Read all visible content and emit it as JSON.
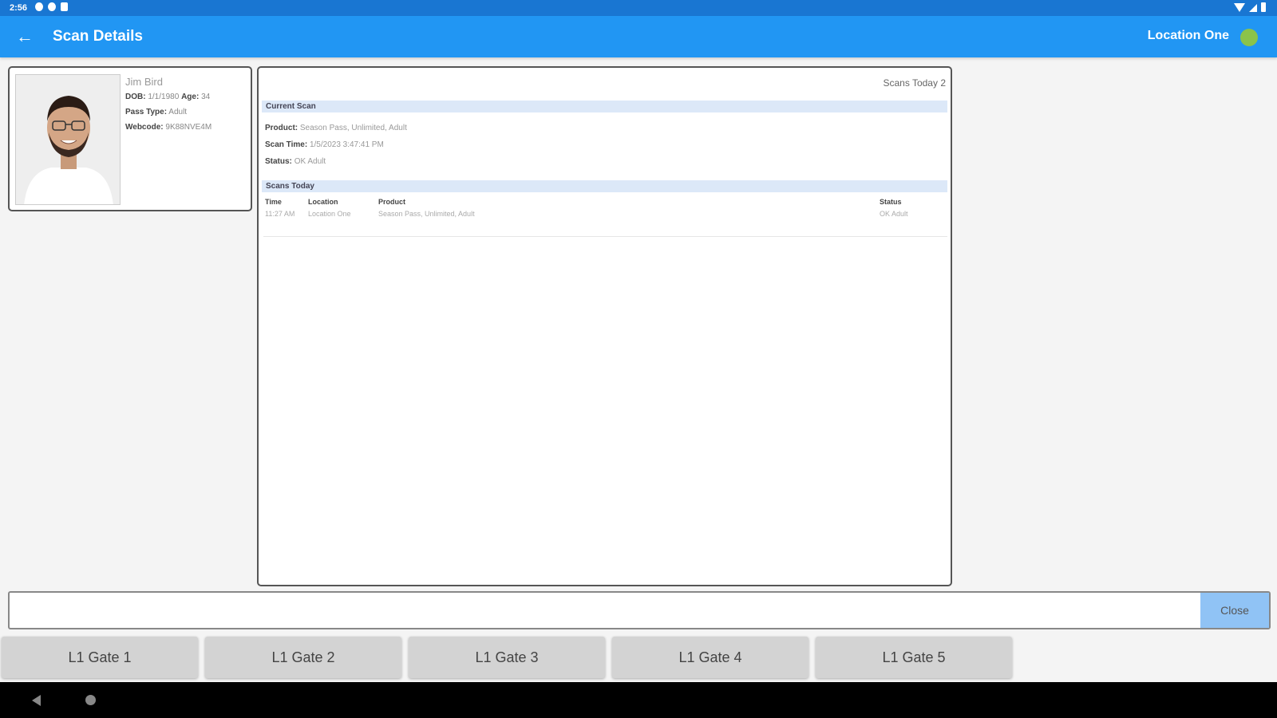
{
  "status_bar": {
    "time": "2:56"
  },
  "app_bar": {
    "title": "Scan Details",
    "location": "Location One",
    "status_color": "#8bc34a"
  },
  "person": {
    "name": "Jim Bird",
    "dob_label": "DOB:",
    "dob": "1/1/1980",
    "age_label": "Age:",
    "age": "34",
    "pass_type_label": "Pass Type:",
    "pass_type": "Adult",
    "webcode_label": "Webcode:",
    "webcode": "9K88NVE4M"
  },
  "detail": {
    "scans_today_label": "Scans Today",
    "scans_today_count": "2",
    "current_scan_header": "Current Scan",
    "product_label": "Product:",
    "product": "Season Pass, Unlimited, Adult",
    "scan_time_label": "Scan Time:",
    "scan_time": "1/5/2023 3:47:41 PM",
    "status_label": "Status:",
    "status": "OK Adult",
    "scans_today_header": "Scans Today",
    "columns": {
      "time": "Time",
      "location": "Location",
      "product": "Product",
      "status": "Status"
    },
    "rows": [
      {
        "time": "11:27 AM",
        "location": "Location One",
        "product": "Season Pass, Unlimited, Adult",
        "status": "OK Adult"
      }
    ]
  },
  "input": {
    "value": "",
    "close_label": "Close"
  },
  "gates": [
    "L1 Gate 1",
    "L1 Gate 2",
    "L1 Gate 3",
    "L1 Gate 4",
    "L1 Gate 5"
  ]
}
